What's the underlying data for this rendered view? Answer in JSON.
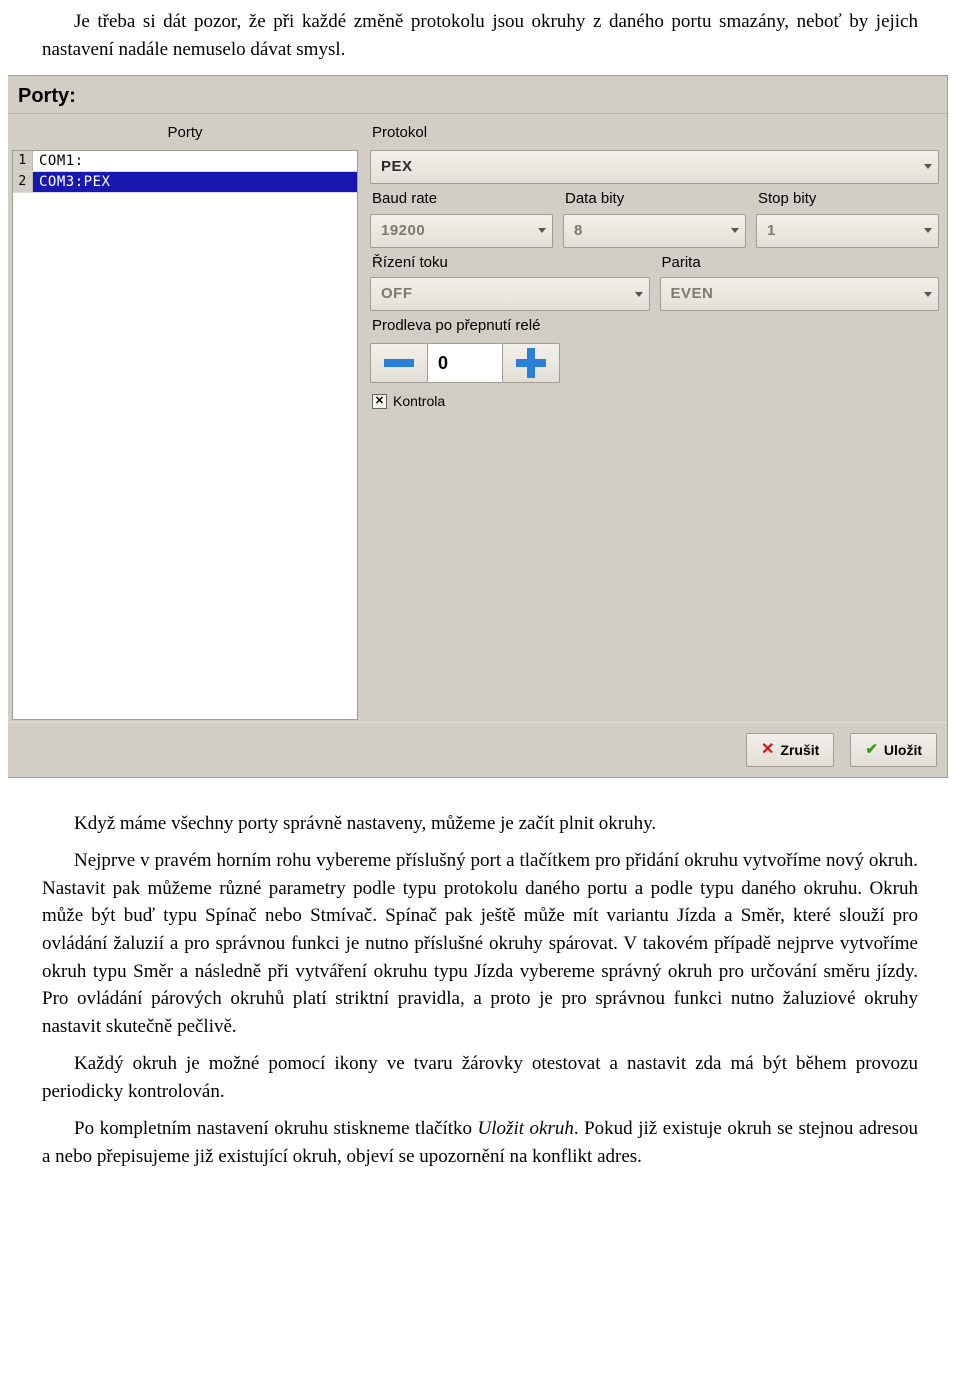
{
  "doc": {
    "p1": "Je třeba si dát pozor, že při každé změně protokolu jsou okruhy z daného portu smazány, neboť by jejich nastavení nadále nemuselo dávat smysl.",
    "p2": "Když máme všechny porty správně nastaveny, můžeme je začít plnit okruhy.",
    "p3": "Nejprve v pravém horním rohu vybereme příslušný port a tlačítkem pro přidání okruhu vytvoříme nový okruh. Nastavit pak můžeme různé parametry podle typu protokolu daného portu a podle typu daného okruhu. Okruh může být buď typu Spínač nebo Stmívač. Spínač pak ještě může mít variantu Jízda a Směr, které slouží pro ovládání žaluzií a pro správnou funkci je nutno příslušné okruhy spárovat. V takovém případě nejprve vytvoříme okruh typu Směr a následně při vytváření okruhu typu Jízda vybereme správný okruh pro určování směru jízdy. Pro ovládání párových okruhů platí striktní pravidla, a proto je pro správnou funkci nutno žaluziové okruhy nastavit skutečně pečlivě.",
    "p4": "Každý okruh je možné pomocí ikony ve tvaru žárovky otestovat a nastavit zda má být během provozu periodicky kontrolován.",
    "p5_a": "Po kompletním nastavení okruhu stiskneme tlačítko ",
    "p5_em": "Uložit okruh",
    "p5_b": ". Pokud již existuje okruh se stejnou adresou a nebo přepisujeme již existující okruh, objeví se upozornění na konflikt adres."
  },
  "ui": {
    "title": "Porty:",
    "list_header": "Porty",
    "rows": [
      {
        "num": "1",
        "text": "COM1:"
      },
      {
        "num": "2",
        "text": "COM3:PEX"
      }
    ],
    "labels": {
      "protocol": "Protokol",
      "baud": "Baud rate",
      "data": "Data bity",
      "stop": "Stop bity",
      "flow": "Řízení toku",
      "parity": "Parita",
      "delay": "Prodleva po přepnutí relé",
      "check": "Kontrola"
    },
    "values": {
      "protocol": "PEX",
      "baud": "19200",
      "data": "8",
      "stop": "1",
      "flow": "OFF",
      "parity": "EVEN",
      "delay": "0",
      "check_checked": true
    },
    "buttons": {
      "cancel": "Zrušit",
      "save": "Uložit"
    }
  }
}
